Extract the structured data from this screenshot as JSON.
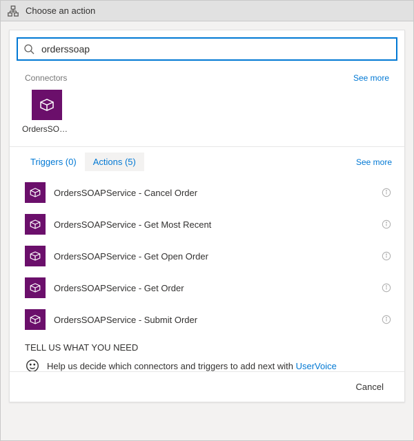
{
  "header": {
    "title": "Choose an action"
  },
  "search": {
    "value": "orderssoap"
  },
  "connectors": {
    "section_label": "Connectors",
    "see_more": "See more",
    "items": [
      {
        "name": "OrdersSOA..."
      }
    ]
  },
  "tabs": {
    "triggers_label": "Triggers (0)",
    "actions_label": "Actions (5)",
    "see_more": "See more"
  },
  "actions": [
    {
      "label": "OrdersSOAPService - Cancel Order"
    },
    {
      "label": "OrdersSOAPService - Get Most Recent"
    },
    {
      "label": "OrdersSOAPService - Get Open Order"
    },
    {
      "label": "OrdersSOAPService - Get Order"
    },
    {
      "label": "OrdersSOAPService - Submit Order"
    }
  ],
  "feedback": {
    "title": "TELL US WHAT YOU NEED",
    "text": "Help us decide which connectors and triggers to add next with ",
    "link_label": "UserVoice"
  },
  "footer": {
    "cancel": "Cancel"
  },
  "colors": {
    "accent": "#0078d4",
    "connector_bg": "#6b0f6b"
  }
}
